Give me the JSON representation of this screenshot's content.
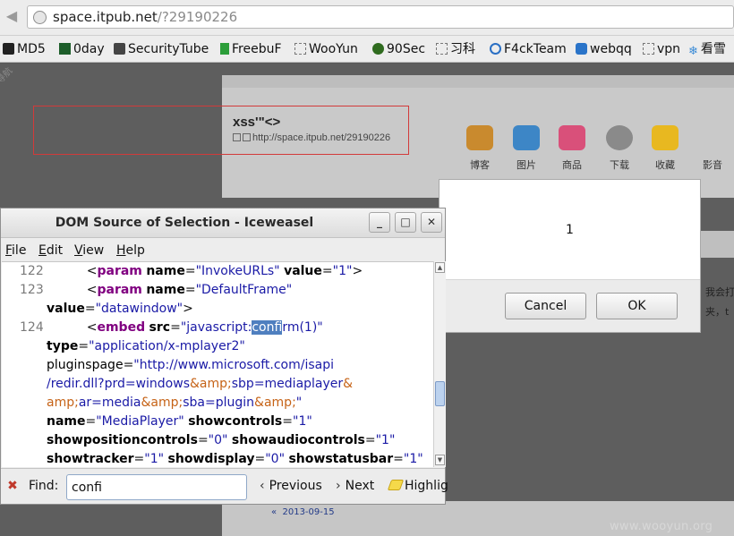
{
  "browser": {
    "url_host": "space.itpub.net",
    "url_path": "/?29190226",
    "bookmarks": [
      {
        "label": "MD5",
        "icon": "md5-icon"
      },
      {
        "label": "0day",
        "icon": "0day-icon"
      },
      {
        "label": "SecurityTube",
        "icon": "securitytube-icon"
      },
      {
        "label": "FreebuF",
        "icon": "freebuf-icon"
      },
      {
        "label": "WooYun",
        "icon": "blank-page-icon"
      },
      {
        "label": "90Sec",
        "icon": "90sec-icon"
      },
      {
        "label": "习科",
        "icon": "blank-page-icon"
      },
      {
        "label": "F4ckTeam",
        "icon": "f4ckteam-icon"
      },
      {
        "label": "webqq",
        "icon": "webqq-icon"
      },
      {
        "label": "vpn",
        "icon": "blank-page-icon"
      },
      {
        "label": "看雪",
        "icon": "snowflake-icon"
      }
    ]
  },
  "page": {
    "nav_tag": "导航",
    "title": "xss'\"<>",
    "url": "http://space.itpub.net/29190226",
    "nav_icons": [
      {
        "label": "博客",
        "color": "#c98a2e"
      },
      {
        "label": "图片",
        "color": "#3d86c6"
      },
      {
        "label": "商品",
        "color": "#d9507a"
      },
      {
        "label": "下载",
        "color": "#8a8a8a"
      },
      {
        "label": "收藏",
        "color": "#e8b820"
      },
      {
        "label": "影音",
        "color": ""
      }
    ],
    "side_text_1": "我会打",
    "side_text_2": "夹，t",
    "date": "2013-09-15",
    "date_prefix": "«",
    "watermark": "www.wooyun.org"
  },
  "alert": {
    "message": "1",
    "cancel_label": "Cancel",
    "ok_label": "OK"
  },
  "dom_window": {
    "title": "DOM Source of Selection - Iceweasel",
    "minimize": "_",
    "maximize": "□",
    "close": "✕",
    "menus": [
      {
        "label": "File",
        "key": "F",
        "rest": "ile"
      },
      {
        "label": "Edit",
        "key": "E",
        "rest": "dit"
      },
      {
        "label": "View",
        "key": "V",
        "rest": "iew"
      },
      {
        "label": "Help",
        "key": "H",
        "rest": "elp"
      }
    ],
    "lines": {
      "l122_num": "122",
      "l122_tag": "param",
      "l122_a1": "name",
      "l122_v1": "\"InvokeURLs\"",
      "l122_a2": "value",
      "l122_v2": "\"1\"",
      "l122_end": ">",
      "l123_num": "123",
      "l123_tag": "param",
      "l123_a1": "name",
      "l123_v1": "\"DefaultFrame\"",
      "l123b_a": "value",
      "l123b_v": "\"datawindow\"",
      "l123b_end": ">",
      "l124_num": "124",
      "l124_tag": "embed",
      "l124_a1": "src",
      "l124_v_pre": "\"javascript:",
      "l124_v_sel": "confi",
      "l124_v_post": "rm(1)\"",
      "l124b_a": "type",
      "l124b_v": "\"application/x-mplayer2\"",
      "l125_a": "pluginspage",
      "l125_v": "\"http://www.microsoft.com/isapi",
      "l126_v1": "/redir.dll?prd=windows",
      "l126_e1": "&amp;",
      "l126_v2": "sbp=mediaplayer",
      "l126_e2": "&",
      "l127_e1": "amp;",
      "l127_v1": "ar=media",
      "l127_e2": "&amp;",
      "l127_v2": "sba=plugin",
      "l127_e3": "&amp;",
      "l127_v3": "\"",
      "l128_a": "name",
      "l128_v": "\"MediaPlayer\"",
      "l128_a2": "showcontrols",
      "l128_v2": "\"1\"",
      "l129_a": "showpositioncontrols",
      "l129_v": "\"0\"",
      "l129_a2": "showaudiocontrols",
      "l129_v2": "\"1\"",
      "l130_a": "showtracker",
      "l130_v": "\"1\"",
      "l130_a2": "showdisplay",
      "l130_v2": "\"0\"",
      "l130_a3": "showstatusbar",
      "l130_v3": "\"1\""
    },
    "find": {
      "label": "Find:",
      "value": "confi",
      "previous": "Previous",
      "next": "Next",
      "highlight": "Highlig"
    }
  }
}
